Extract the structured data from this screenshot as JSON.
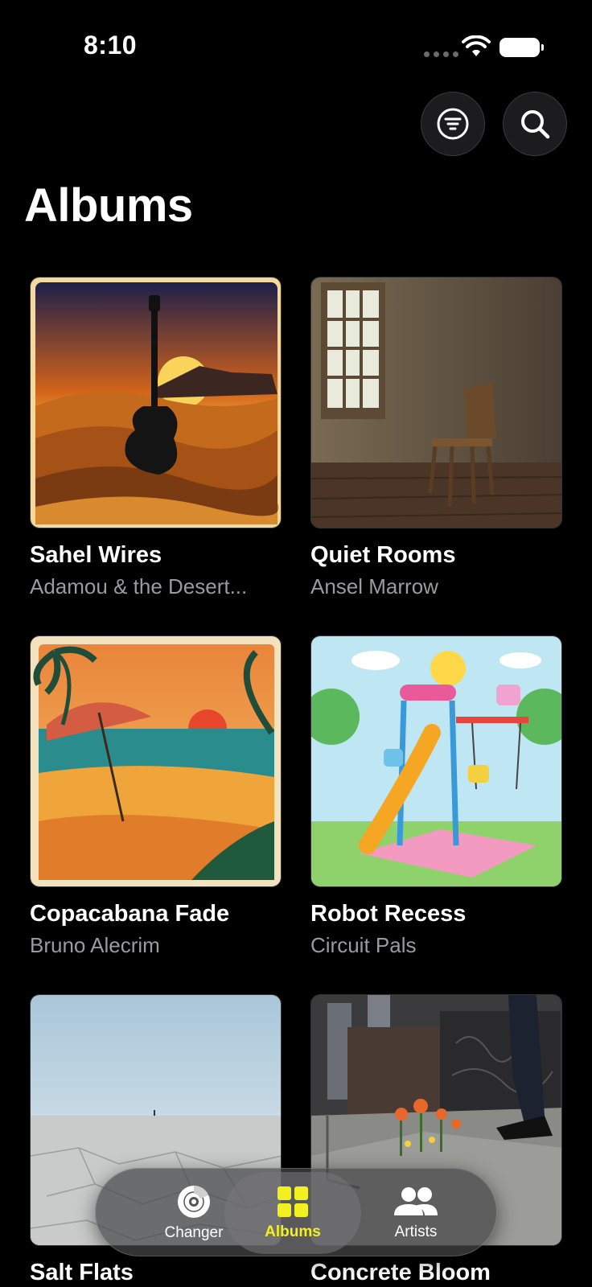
{
  "status": {
    "time": "8:10"
  },
  "header": {
    "title": "Albums",
    "filter_icon": "filter-lines-icon",
    "search_icon": "search-icon"
  },
  "albums": [
    {
      "title": "Sahel Wires",
      "artist": "Adamou & the Desert..."
    },
    {
      "title": "Quiet Rooms",
      "artist": "Ansel Marrow"
    },
    {
      "title": "Copacabana Fade",
      "artist": "Bruno Alecrim"
    },
    {
      "title": "Robot Recess",
      "artist": "Circuit Pals"
    },
    {
      "title": "Salt Flats",
      "artist": ""
    },
    {
      "title": "Concrete Bloom",
      "artist": ""
    }
  ],
  "tabs": [
    {
      "label": "Changer",
      "icon": "disc-icon",
      "active": false
    },
    {
      "label": "Albums",
      "icon": "grid-icon",
      "active": true
    },
    {
      "label": "Artists",
      "icon": "people-icon",
      "active": false
    }
  ],
  "colors": {
    "accent": "#f3f020",
    "background": "#000000",
    "secondary_text": "#9a9a9f"
  }
}
